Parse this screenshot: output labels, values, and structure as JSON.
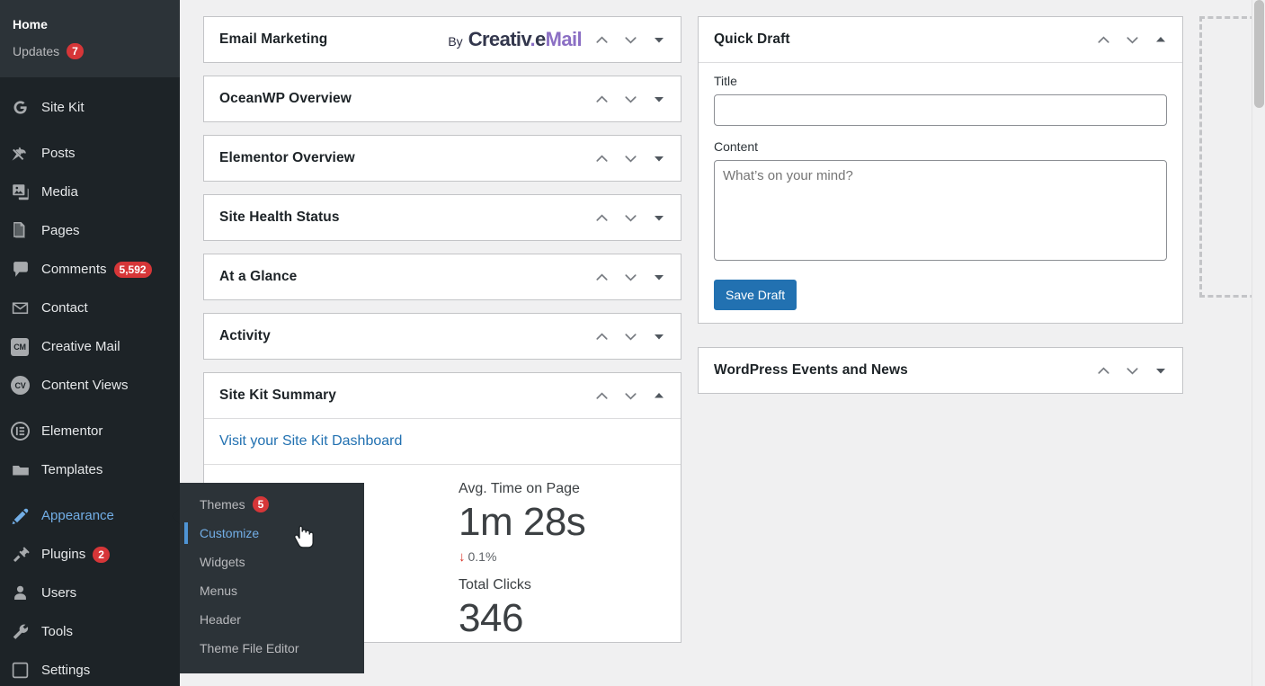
{
  "sidebar": {
    "top_subnav": [
      {
        "label": "Home",
        "current": true
      },
      {
        "label": "Updates",
        "badge": "7"
      }
    ],
    "items": [
      {
        "label": "Site Kit",
        "icon": "google-g-icon"
      },
      {
        "label": "Posts",
        "icon": "pin-icon"
      },
      {
        "label": "Media",
        "icon": "media-icon"
      },
      {
        "label": "Pages",
        "icon": "pages-icon"
      },
      {
        "label": "Comments",
        "icon": "comment-bubble-icon",
        "badge": "5,592"
      },
      {
        "label": "Contact",
        "icon": "envelope-icon"
      },
      {
        "label": "Creative Mail",
        "icon": "cm-icon"
      },
      {
        "label": "Content Views",
        "icon": "cv-icon"
      },
      {
        "label": "Elementor",
        "icon": "elementor-icon"
      },
      {
        "label": "Templates",
        "icon": "folder-icon"
      },
      {
        "label": "Appearance",
        "icon": "paintbrush-icon",
        "active": true
      },
      {
        "label": "Plugins",
        "icon": "plug-icon",
        "badge": "2"
      },
      {
        "label": "Users",
        "icon": "user-icon"
      },
      {
        "label": "Tools",
        "icon": "wrench-icon"
      },
      {
        "label": "Settings",
        "icon": "settings-sliders-icon"
      }
    ]
  },
  "flyout": {
    "items": [
      {
        "label": "Themes",
        "badge": "5"
      },
      {
        "label": "Customize",
        "current": true
      },
      {
        "label": "Widgets"
      },
      {
        "label": "Menus"
      },
      {
        "label": "Header"
      },
      {
        "label": "Theme File Editor"
      }
    ]
  },
  "widgets_left": [
    {
      "title": "Email Marketing",
      "brand_by": "By",
      "brand_part1": "Creativ",
      "brand_dot": ".",
      "brand_part2": "e",
      "brand_part3": "Mail",
      "collapsed": true
    },
    {
      "title": "OceanWP Overview",
      "collapsed": true
    },
    {
      "title": "Elementor Overview",
      "collapsed": true
    },
    {
      "title": "Site Health Status",
      "collapsed": true
    },
    {
      "title": "At a Glance",
      "collapsed": true
    },
    {
      "title": "Activity",
      "collapsed": true
    },
    {
      "title": "Site Kit Summary",
      "collapsed": false
    }
  ],
  "site_kit_summary": {
    "dashboard_link": "Visit your Site Kit Dashboard",
    "stats": [
      {
        "label": "Avg. Time on Page",
        "value": "1m 28s",
        "delta": "0.1%",
        "delta_direction": "down",
        "delta_color": "#d93025"
      },
      {
        "label": "Total Clicks",
        "value": "346"
      }
    ]
  },
  "quick_draft": {
    "title": "Quick Draft",
    "title_label": "Title",
    "title_value": "",
    "title_placeholder": "",
    "content_label": "Content",
    "content_value": "",
    "content_placeholder": "What’s on your mind?",
    "save_label": "Save Draft"
  },
  "events_news": {
    "title": "WordPress Events and News"
  },
  "icons": {
    "chevron_up": "chevron-up-icon",
    "chevron_down": "chevron-down-icon",
    "triangle_down": "triangle-down-icon",
    "triangle_up": "triangle-up-icon"
  },
  "colors": {
    "accent_blue": "#2271b1",
    "sidebar_bg": "#1d2327",
    "sidebar_sub_bg": "#2c3338",
    "badge_red": "#d63638",
    "link_blue": "#72aee6",
    "brand_purple": "#8b6fc4",
    "page_bg": "#f0f0f1"
  }
}
